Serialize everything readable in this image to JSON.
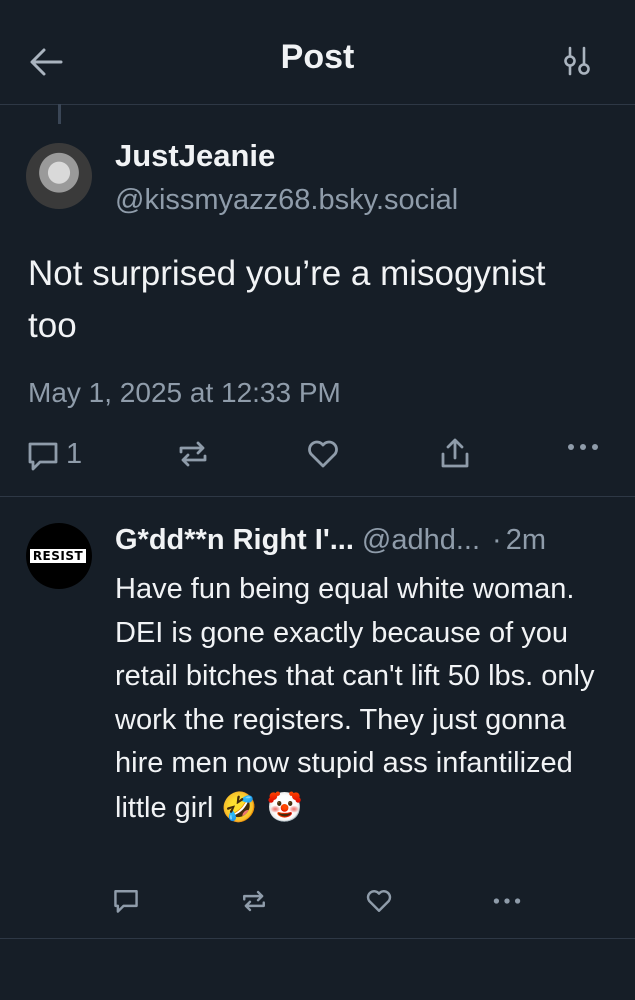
{
  "header": {
    "title": "Post",
    "back_icon": "arrow-left-icon",
    "filter_icon": "sliders-icon"
  },
  "post": {
    "author_name": "JustJeanie",
    "author_handle": "@kissmyazz68.bsky.social",
    "text": "Not surprised you’re a misogynist too",
    "timestamp": "May 1, 2025 at 12:33 PM",
    "reply_count": "1"
  },
  "reply": {
    "author_name": "G*dd**n Right I'...",
    "author_handle": "@adhd...",
    "separator": "·",
    "time": "2m",
    "avatar_text": "RESIST",
    "text": "Have fun being equal white woman. DEI is gone exactly because of you retail bitches that can't lift 50 lbs. only work the registers. They just gonna hire men now stupid ass infantilized little girl",
    "emojis": "🤣 🤡"
  },
  "colors": {
    "background": "#161e27",
    "text": "#f1f3f5",
    "muted": "#8f9caa",
    "divider": "#2e3845"
  }
}
